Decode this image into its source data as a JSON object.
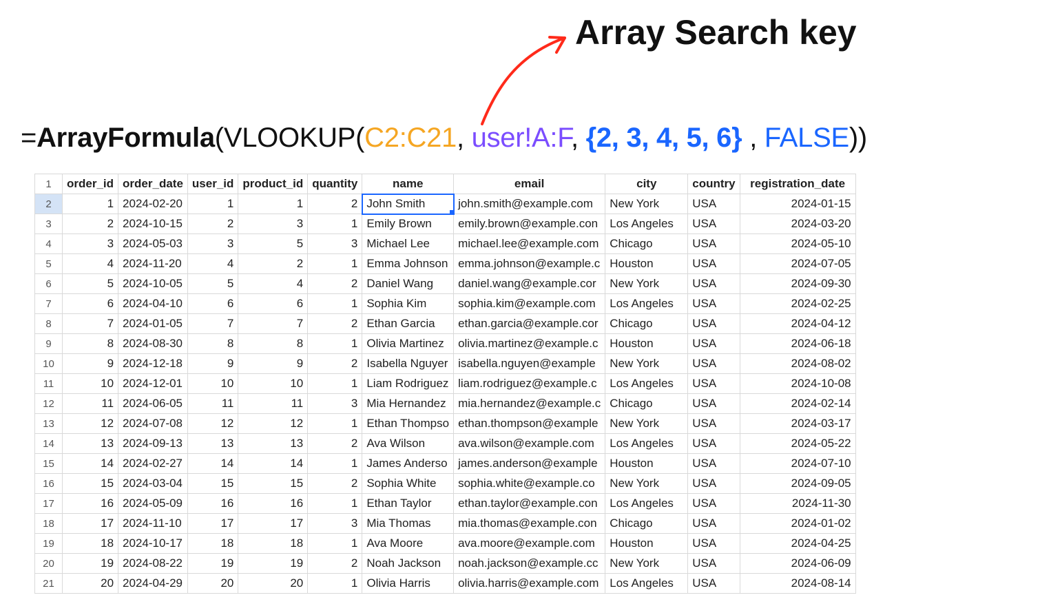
{
  "annotation": "Array Search key",
  "formula": {
    "eq": "=",
    "af": "ArrayFormula",
    "open1": "(",
    "vl": "VLOOKUP",
    "open2": "(",
    "range1": "C2:C21",
    "c1": ", ",
    "sheetref": "user!A:F",
    "c2": ", ",
    "braces": "{2, 3, 4, 5, 6}",
    "c3": " , ",
    "false": "FALSE",
    "close": "))"
  },
  "headers": {
    "order_id": "order_id",
    "order_date": "order_date",
    "user_id": "user_id",
    "product_id": "product_id",
    "quantity": "quantity",
    "name": "name",
    "email": "email",
    "city": "city",
    "country": "country",
    "registration_date": "registration_date"
  },
  "rows": [
    {
      "rn": "1"
    },
    {
      "rn": "2",
      "order_id": "1",
      "order_date": "2024-02-20",
      "user_id": "1",
      "product_id": "1",
      "quantity": "2",
      "name": "John Smith",
      "email": "john.smith@example.com",
      "city": "New York",
      "country": "USA",
      "registration_date": "2024-01-15"
    },
    {
      "rn": "3",
      "order_id": "2",
      "order_date": "2024-10-15",
      "user_id": "2",
      "product_id": "3",
      "quantity": "1",
      "name": "Emily Brown",
      "email": "emily.brown@example.con",
      "city": "Los Angeles",
      "country": "USA",
      "registration_date": "2024-03-20"
    },
    {
      "rn": "4",
      "order_id": "3",
      "order_date": "2024-05-03",
      "user_id": "3",
      "product_id": "5",
      "quantity": "3",
      "name": "Michael Lee",
      "email": "michael.lee@example.com",
      "city": "Chicago",
      "country": "USA",
      "registration_date": "2024-05-10"
    },
    {
      "rn": "5",
      "order_id": "4",
      "order_date": "2024-11-20",
      "user_id": "4",
      "product_id": "2",
      "quantity": "1",
      "name": "Emma Johnson",
      "email": "emma.johnson@example.c",
      "city": "Houston",
      "country": "USA",
      "registration_date": "2024-07-05"
    },
    {
      "rn": "6",
      "order_id": "5",
      "order_date": "2024-10-05",
      "user_id": "5",
      "product_id": "4",
      "quantity": "2",
      "name": "Daniel Wang",
      "email": "daniel.wang@example.cor",
      "city": "New York",
      "country": "USA",
      "registration_date": "2024-09-30"
    },
    {
      "rn": "7",
      "order_id": "6",
      "order_date": "2024-04-10",
      "user_id": "6",
      "product_id": "6",
      "quantity": "1",
      "name": "Sophia Kim",
      "email": "sophia.kim@example.com",
      "city": "Los Angeles",
      "country": "USA",
      "registration_date": "2024-02-25"
    },
    {
      "rn": "8",
      "order_id": "7",
      "order_date": "2024-01-05",
      "user_id": "7",
      "product_id": "7",
      "quantity": "2",
      "name": "Ethan Garcia",
      "email": "ethan.garcia@example.cor",
      "city": "Chicago",
      "country": "USA",
      "registration_date": "2024-04-12"
    },
    {
      "rn": "9",
      "order_id": "8",
      "order_date": "2024-08-30",
      "user_id": "8",
      "product_id": "8",
      "quantity": "1",
      "name": "Olivia Martinez",
      "email": "olivia.martinez@example.c",
      "city": "Houston",
      "country": "USA",
      "registration_date": "2024-06-18"
    },
    {
      "rn": "10",
      "order_id": "9",
      "order_date": "2024-12-18",
      "user_id": "9",
      "product_id": "9",
      "quantity": "2",
      "name": "Isabella Nguyer",
      "email": "isabella.nguyen@example",
      "city": "New York",
      "country": "USA",
      "registration_date": "2024-08-02"
    },
    {
      "rn": "11",
      "order_id": "10",
      "order_date": "2024-12-01",
      "user_id": "10",
      "product_id": "10",
      "quantity": "1",
      "name": "Liam Rodriguez",
      "email": "liam.rodriguez@example.c",
      "city": "Los Angeles",
      "country": "USA",
      "registration_date": "2024-10-08"
    },
    {
      "rn": "12",
      "order_id": "11",
      "order_date": "2024-06-05",
      "user_id": "11",
      "product_id": "11",
      "quantity": "3",
      "name": "Mia Hernandez",
      "email": "mia.hernandez@example.c",
      "city": "Chicago",
      "country": "USA",
      "registration_date": "2024-02-14"
    },
    {
      "rn": "13",
      "order_id": "12",
      "order_date": "2024-07-08",
      "user_id": "12",
      "product_id": "12",
      "quantity": "1",
      "name": "Ethan Thompso",
      "email": "ethan.thompson@example",
      "city": "New York",
      "country": "USA",
      "registration_date": "2024-03-17"
    },
    {
      "rn": "14",
      "order_id": "13",
      "order_date": "2024-09-13",
      "user_id": "13",
      "product_id": "13",
      "quantity": "2",
      "name": "Ava Wilson",
      "email": "ava.wilson@example.com",
      "city": "Los Angeles",
      "country": "USA",
      "registration_date": "2024-05-22"
    },
    {
      "rn": "15",
      "order_id": "14",
      "order_date": "2024-02-27",
      "user_id": "14",
      "product_id": "14",
      "quantity": "1",
      "name": "James Anderso",
      "email": "james.anderson@example",
      "city": "Houston",
      "country": "USA",
      "registration_date": "2024-07-10"
    },
    {
      "rn": "16",
      "order_id": "15",
      "order_date": "2024-03-04",
      "user_id": "15",
      "product_id": "15",
      "quantity": "2",
      "name": "Sophia White",
      "email": "sophia.white@example.co",
      "city": "New York",
      "country": "USA",
      "registration_date": "2024-09-05"
    },
    {
      "rn": "17",
      "order_id": "16",
      "order_date": "2024-05-09",
      "user_id": "16",
      "product_id": "16",
      "quantity": "1",
      "name": "Ethan Taylor",
      "email": "ethan.taylor@example.con",
      "city": "Los Angeles",
      "country": "USA",
      "registration_date": "2024-11-30"
    },
    {
      "rn": "18",
      "order_id": "17",
      "order_date": "2024-11-10",
      "user_id": "17",
      "product_id": "17",
      "quantity": "3",
      "name": "Mia Thomas",
      "email": "mia.thomas@example.con",
      "city": "Chicago",
      "country": "USA",
      "registration_date": "2024-01-02"
    },
    {
      "rn": "19",
      "order_id": "18",
      "order_date": "2024-10-17",
      "user_id": "18",
      "product_id": "18",
      "quantity": "1",
      "name": "Ava Moore",
      "email": "ava.moore@example.com",
      "city": "Houston",
      "country": "USA",
      "registration_date": "2024-04-25"
    },
    {
      "rn": "20",
      "order_id": "19",
      "order_date": "2024-08-22",
      "user_id": "19",
      "product_id": "19",
      "quantity": "2",
      "name": "Noah Jackson",
      "email": "noah.jackson@example.cc",
      "city": "New York",
      "country": "USA",
      "registration_date": "2024-06-09"
    },
    {
      "rn": "21",
      "order_id": "20",
      "order_date": "2024-04-29",
      "user_id": "20",
      "product_id": "20",
      "quantity": "1",
      "name": "Olivia Harris",
      "email": "olivia.harris@example.com",
      "city": "Los Angeles",
      "country": "USA",
      "registration_date": "2024-08-14"
    }
  ],
  "active_cell_row": 1,
  "columns_order": [
    "order_id",
    "order_date",
    "user_id",
    "product_id",
    "quantity",
    "name",
    "email",
    "city",
    "country",
    "registration_date"
  ]
}
